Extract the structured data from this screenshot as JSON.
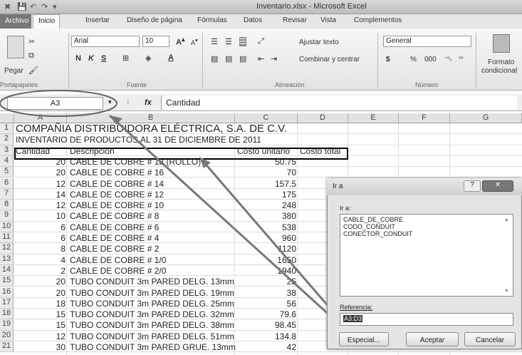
{
  "window": {
    "title": "Inventario.xlsx - Microsoft Excel"
  },
  "quick_access": [
    "✖",
    "💾",
    "↶",
    "↷",
    "▾"
  ],
  "menu": {
    "archivo": "Archivo",
    "tabs": [
      "Inicio",
      "Insertar",
      "Diseño de página",
      "Fórmulas",
      "Datos",
      "Revisar",
      "Vista",
      "Complementos"
    ]
  },
  "ribbon": {
    "paste": "Pegar",
    "clipboard_group": "Portapapeles",
    "font_name": "Arial",
    "font_size": "10",
    "font_group": "Fuente",
    "bold": "N",
    "italic": "K",
    "underline": "S",
    "wrap": "Ajustar texto",
    "merge": "Combinar y centrar",
    "align_group": "Alineación",
    "number_format": "General",
    "currency": "$",
    "percent": "%",
    "thousands": "000",
    "dec_inc": "⁺⁰₀",
    "dec_dec": "⁰⁰",
    "number_group": "Número",
    "cond_format": "Formato",
    "cond_format2": "condicional"
  },
  "formula": {
    "name_box": "A3",
    "fx": "fx",
    "content": "Cantidad"
  },
  "columns": [
    "A",
    "B",
    "C",
    "D",
    "E",
    "F",
    "G"
  ],
  "rows": [
    {
      "n": "1",
      "a": "",
      "b": "COMPAÑIA DISTRIBUIDORA ELÉCTRICA, S.A. DE C.V.",
      "c": "",
      "d": ""
    },
    {
      "n": "2",
      "a": "",
      "b": "INVENTARIO DE PRODUCTOS AL 31 DE DICIEMBRE DE 2011",
      "c": "",
      "d": ""
    },
    {
      "n": "3",
      "a": "Cantidad",
      "b": "Descripción",
      "c": "Costo unitario",
      "d": "Costo total"
    },
    {
      "n": "4",
      "a": "20",
      "b": "CABLE DE COBRE # 18 (ROLLO)",
      "c": "50.75",
      "d": ""
    },
    {
      "n": "5",
      "a": "20",
      "b": "CABLE DE COBRE # 16",
      "c": "70",
      "d": ""
    },
    {
      "n": "6",
      "a": "12",
      "b": "CABLE DE COBRE # 14",
      "c": "157.5",
      "d": ""
    },
    {
      "n": "7",
      "a": "14",
      "b": "CABLE DE COBRE # 12",
      "c": "175",
      "d": ""
    },
    {
      "n": "8",
      "a": "12",
      "b": "CABLE DE COBRE # 10",
      "c": "248",
      "d": ""
    },
    {
      "n": "9",
      "a": "10",
      "b": "CABLE DE COBRE # 8",
      "c": "380",
      "d": ""
    },
    {
      "n": "10",
      "a": "6",
      "b": "CABLE DE COBRE # 6",
      "c": "538",
      "d": ""
    },
    {
      "n": "11",
      "a": "6",
      "b": "CABLE DE COBRE # 4",
      "c": "960",
      "d": ""
    },
    {
      "n": "12",
      "a": "8",
      "b": "CABLE DE COBRE # 2",
      "c": "1120",
      "d": ""
    },
    {
      "n": "13",
      "a": "4",
      "b": "CABLE DE COBRE # 1/0",
      "c": "1650",
      "d": ""
    },
    {
      "n": "14",
      "a": "2",
      "b": "CABLE DE COBRE # 2/0",
      "c": "1940",
      "d": ""
    },
    {
      "n": "15",
      "a": "20",
      "b": "TUBO CONDUIT 3m PARED DELG. 13mm",
      "c": "25",
      "d": ""
    },
    {
      "n": "16",
      "a": "20",
      "b": "TUBO CONDUIT 3m PARED DELG. 19mm",
      "c": "38",
      "d": ""
    },
    {
      "n": "17",
      "a": "18",
      "b": "TUBO CONDUIT 3m PARED DELG. 25mm",
      "c": "56",
      "d": ""
    },
    {
      "n": "18",
      "a": "15",
      "b": "TUBO CONDUIT 3m PARED DELG. 32mm",
      "c": "79.6",
      "d": ""
    },
    {
      "n": "19",
      "a": "15",
      "b": "TUBO CONDUIT 3m PARED DELG. 38mm",
      "c": "98.45",
      "d": ""
    },
    {
      "n": "20",
      "a": "12",
      "b": "TUBO CONDUIT 3m PARED DELG. 51mm",
      "c": "134.8",
      "d": ""
    },
    {
      "n": "21",
      "a": "30",
      "b": "TUBO CONDUIT 3m PARED GRUE. 13mm",
      "c": "42",
      "d": ""
    }
  ],
  "dialog": {
    "title": "Ir a",
    "go_to_label": "Ir a:",
    "items": [
      "CABLE_DE_COBRE",
      "CODO_CONDUIT",
      "CONECTOR_CONDUIT"
    ],
    "ref_label": "Referencia:",
    "ref_value": "A3:D3",
    "special": "Especial...",
    "ok": "Aceptar",
    "cancel": "Cancelar",
    "help": "?",
    "close": "✕"
  }
}
